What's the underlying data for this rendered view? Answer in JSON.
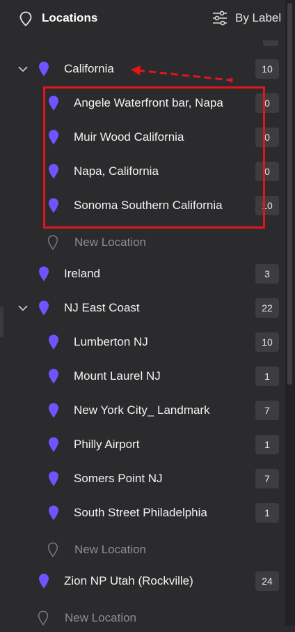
{
  "header": {
    "title": "Locations",
    "group_by": "By Label"
  },
  "groups": [
    {
      "name": "California",
      "count": "10",
      "expanded": true,
      "children": [
        {
          "name": "Angele Waterfront bar, Napa",
          "count": "0"
        },
        {
          "name": "Muir Wood California",
          "count": "0"
        },
        {
          "name": "Napa, California",
          "count": "0"
        },
        {
          "name": "Sonoma Southern California",
          "count": "10"
        }
      ],
      "new_location": "New Location"
    },
    {
      "name": "Ireland",
      "count": "3"
    },
    {
      "name": "NJ East Coast",
      "count": "22",
      "expanded": true,
      "children": [
        {
          "name": "Lumberton NJ",
          "count": "10"
        },
        {
          "name": "Mount Laurel NJ",
          "count": "1"
        },
        {
          "name": "New York City_ Landmark",
          "count": "7"
        },
        {
          "name": "Philly Airport",
          "count": "1"
        },
        {
          "name": "Somers Point NJ",
          "count": "7"
        },
        {
          "name": "South Street Philadelphia",
          "count": "1"
        }
      ],
      "new_location": "New Location"
    },
    {
      "name": "Zion NP Utah (Rockville)",
      "count": "24"
    }
  ],
  "root_new_location": "New Location",
  "colors": {
    "pin": "#7153ff",
    "annotation": "#e3151b",
    "background": "#2b2b2d"
  }
}
